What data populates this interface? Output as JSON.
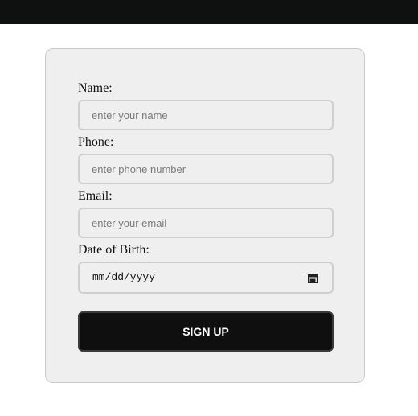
{
  "form": {
    "name": {
      "label": "Name:",
      "placeholder": "enter your name",
      "value": ""
    },
    "phone": {
      "label": "Phone:",
      "placeholder": "enter phone number",
      "value": ""
    },
    "email": {
      "label": "Email:",
      "placeholder": "enter your email",
      "value": ""
    },
    "dob": {
      "label": "Date of Birth:",
      "placeholder": "mm/dd/yyyy",
      "icon": "calendar-icon"
    },
    "submit_label": "SIGN UP"
  },
  "colors": {
    "topbar": "#0f1111",
    "card_background": "#efefef",
    "button_background": "#0f0f0f",
    "button_text": "#ffffff"
  }
}
